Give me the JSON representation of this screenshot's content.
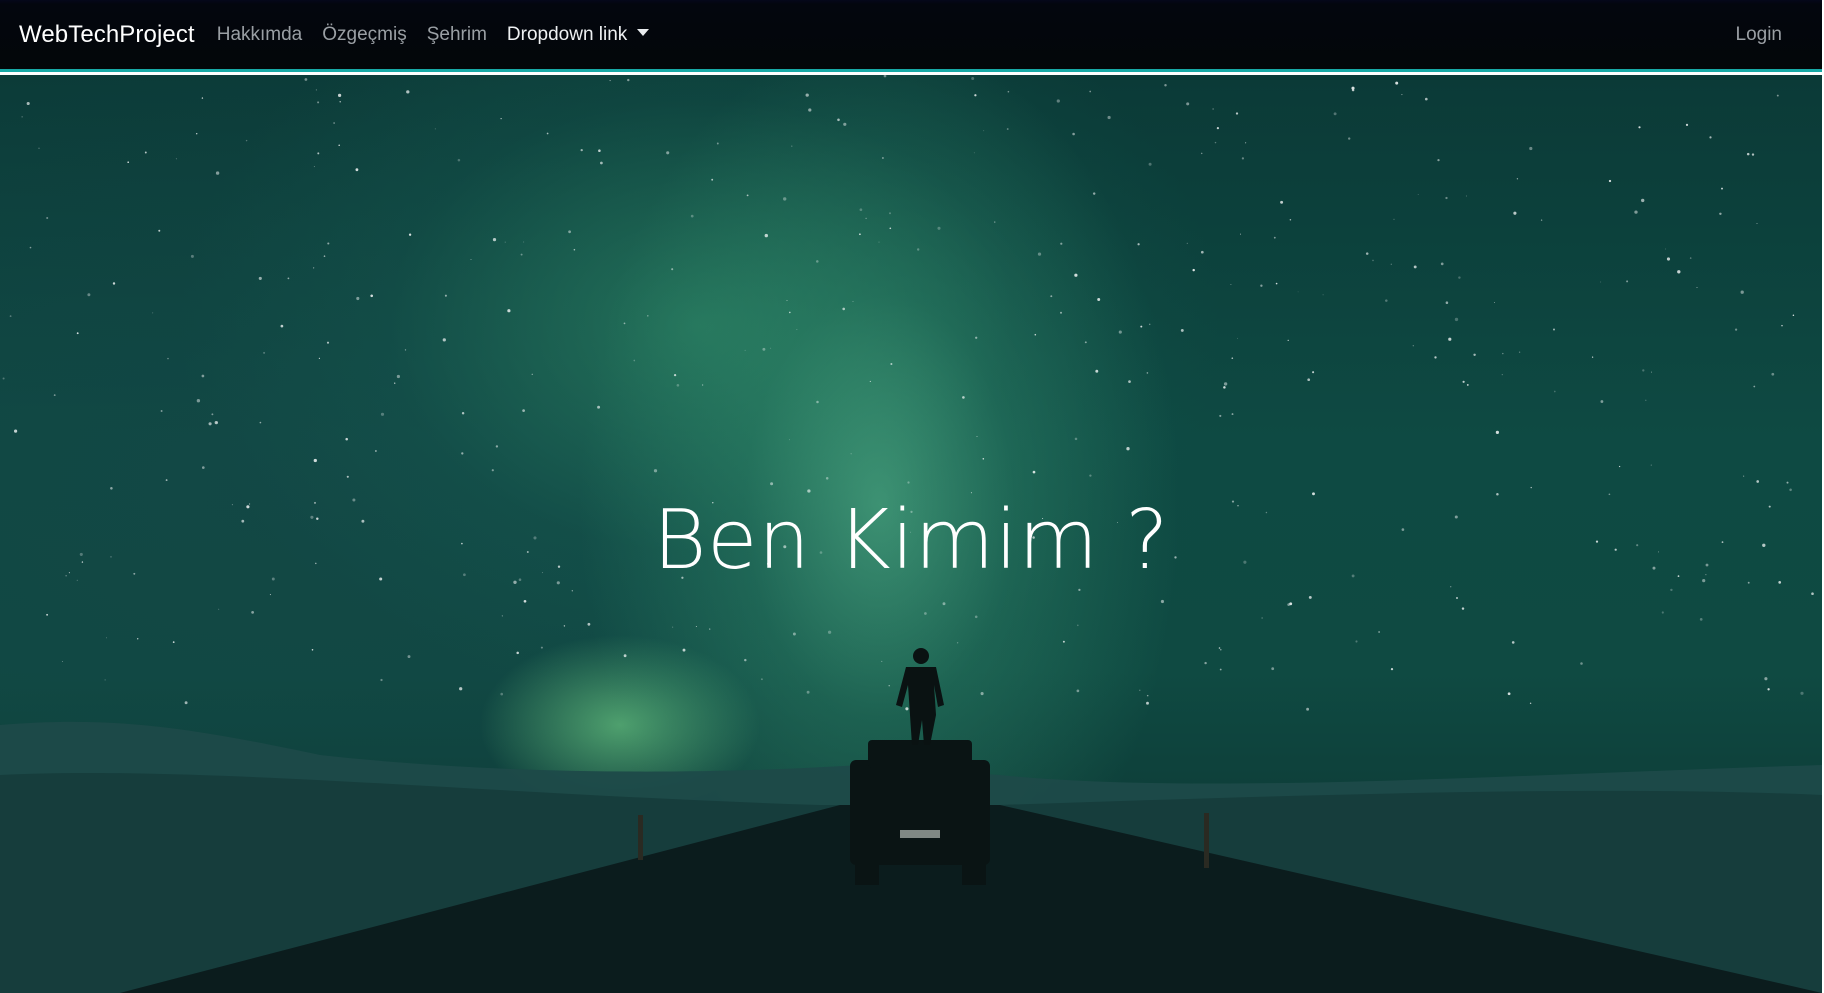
{
  "navbar": {
    "brand": "WebTechProject",
    "links": [
      {
        "label": "Hakkımda"
      },
      {
        "label": "Özgeçmiş"
      },
      {
        "label": "Şehrim"
      },
      {
        "label": "Dropdown link"
      }
    ],
    "login": "Login"
  },
  "hero": {
    "title": "Ben Kimim ?"
  },
  "colors": {
    "navbar_bg": "#030709",
    "navbar_border": "#17a9a6",
    "link_muted": "#9a9fa4",
    "link_active": "#eef0f2"
  }
}
